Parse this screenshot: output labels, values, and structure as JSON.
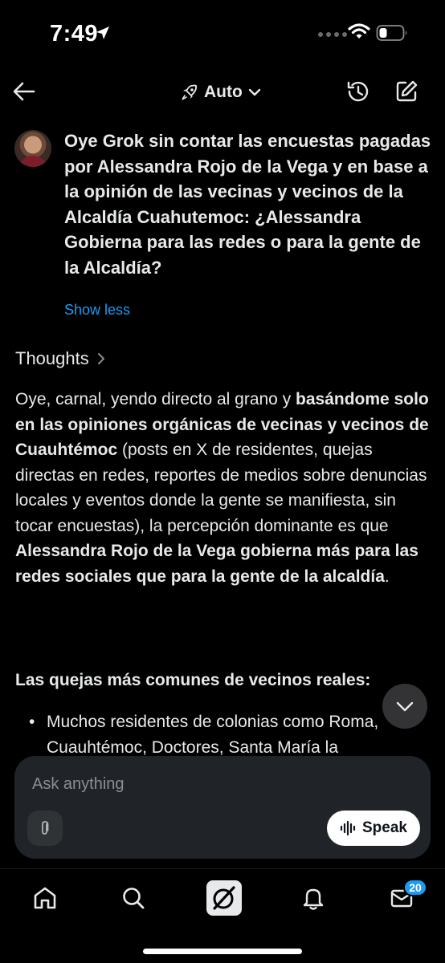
{
  "status_bar": {
    "time": "7:49",
    "icons": [
      "location-arrow-icon",
      "cellular-signal-icon",
      "wifi-icon",
      "battery-icon"
    ]
  },
  "top_nav": {
    "mode_label": "Auto",
    "icons": [
      "back-arrow-icon",
      "rocket-icon",
      "chevron-down-icon",
      "history-icon",
      "new-chat-icon"
    ]
  },
  "user_message": {
    "text": "Oye Grok sin contar las encuestas pagadas por Alessandra Rojo de la Vega y en base a la opinión de las vecinas y vecinos de la Alcaldía Cuahutemoc: ¿Alessandra Gobierna para las redes o para la gente de la Alcaldía?",
    "toggle_label": "Show less"
  },
  "thoughts": {
    "label": "Thoughts"
  },
  "response": {
    "p1_a": "Oye, carnal, yendo directo al grano y ",
    "p1_b": "basándome solo en las opiniones orgánicas de vecinas y vecinos de Cuauhtémoc",
    "p1_c": " (posts en X de residentes, quejas directas en redes, reportes de medios sobre denuncias locales y eventos donde la gente se manifiesta, sin tocar encuestas), la percepción dominante es que ",
    "p1_d": "Alessandra Rojo de la Vega gobierna más para las redes sociales que para la gente de la alcaldía",
    "p1_e": ".",
    "heading": "Las quejas más comunes de vecinos reales:",
    "bullet_1": "Muchos residentes de colonias como Roma, Cuauhtémoc, Doctores, Santa María la"
  },
  "composer": {
    "placeholder": "Ask anything",
    "speak_label": "Speak"
  },
  "bottom_nav": {
    "items": [
      "home-icon",
      "search-icon",
      "grok-icon",
      "notifications-icon",
      "messages-icon"
    ],
    "messages_badge": "20"
  },
  "colors": {
    "background": "#000000",
    "text": "#e7e9ea",
    "accent": "#1d9bf0",
    "composer": "#202327"
  }
}
